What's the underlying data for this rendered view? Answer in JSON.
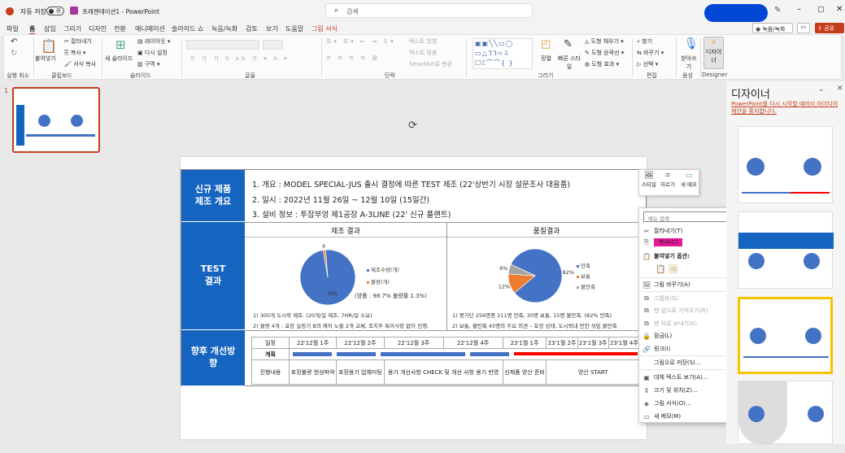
{
  "titlebar": {
    "autosave_label": "자동 저장",
    "autosave_state": "끔",
    "doc_title": "프레젠테이션1 - PowerPoint",
    "search_placeholder": "검색"
  },
  "tabs": [
    "파일",
    "홈",
    "삽입",
    "그리기",
    "디자인",
    "전환",
    "애니메이션",
    "슬라이드 쇼",
    "녹음/녹화",
    "검토",
    "보기",
    "도움말",
    "그림 서식"
  ],
  "header_buttons": {
    "record": "녹음/녹화",
    "share": "공유"
  },
  "ribbon": {
    "undo_group": "실행 취소",
    "clipboard": {
      "paste": "붙여넣기",
      "cut": "잘라내기",
      "copy": "복사",
      "format_painter": "서식 복사",
      "label": "클립보드"
    },
    "slides": {
      "new_slide": "새 슬라이드",
      "layout": "레이아웃",
      "reset": "다시 설정",
      "section": "구역",
      "label": "슬라이드"
    },
    "font": {
      "label": "글꼴"
    },
    "paragraph": {
      "text_direction": "텍스트 방향",
      "align_text": "텍스트 맞춤",
      "smartart": "SmartArt로 변환",
      "label": "단락"
    },
    "drawing": {
      "arrange": "정렬",
      "quick_styles": "빠른 스타일",
      "shape_fill": "도형 채우기",
      "shape_outline": "도형 윤곽선",
      "shape_effects": "도형 효과",
      "label": "그리기"
    },
    "editing": {
      "find": "찾기",
      "replace": "바꾸기",
      "select": "선택",
      "label": "편집"
    },
    "voice": {
      "dictate": "받아쓰기",
      "label": "음성"
    },
    "designer": {
      "button": "디자이너",
      "label": "Designer"
    }
  },
  "thumbnail": {
    "number": "1"
  },
  "slide": {
    "section1": "신규 제품 제조 개요",
    "overview": [
      "1. 개요 : MODEL SPECIAL-JUS 출시 결정에 따른 TEST 제조 (22'상반기 시장 설문조사 대응품)",
      "2. 일시 : 2022년 11월 26일 ~ 12월 10일 (15일간)",
      "3. 설비 정보 : 투잡부엉 제1공장 A-3LINE (22' 신규 플랜트)"
    ],
    "section2": "TEST 결과",
    "mfg_title": "제조 결과",
    "quality_title": "품질결과",
    "mfg_summary": "(양품 : 98.7% 불량률 1.3%)",
    "mfg_notes": [
      "1) 300개 도시락 제조. (20개/일 제조, 7HR/일 소요)",
      "2) 불량 4개 : 포장 실링기 B의 에어 노즐 2개 교체, 조치후 특이사항 없이 진행."
    ],
    "quality_notes": [
      "1) 평가단 256명중 211명 만족, 30명 보통, 15명 불만족. (82% 만족)",
      "2) 보통, 불만족 45명의 주요 의견 – 포장 상태, 도시락내 반찬 섞임 불만족"
    ],
    "section3": "향후 개선방향",
    "schedule": {
      "row_labels": [
        "일정",
        "계획",
        "진행내용"
      ],
      "weeks": [
        "22'12월 1주",
        "22'12월 2주",
        "22'12월 3주",
        "22'12월 4주",
        "23'1월 1주",
        "23'1월 2주",
        "23'1월 3주",
        "23'1월 4주"
      ],
      "tasks": [
        "포장불량 현상파악",
        "포장용기 업체미팅",
        "용기 개선사항 CHECK 및 개선 사항 용기 반영",
        "신제품 양산 준비",
        "양산 START"
      ]
    }
  },
  "chart_data": [
    {
      "type": "pie",
      "title": "제조 결과",
      "categories": [
        "제조수량(개)",
        "불량(개)"
      ],
      "values": [
        300,
        4
      ],
      "data_labels": [
        "300",
        "4"
      ],
      "colors": [
        "#4472c4",
        "#ed7d31"
      ],
      "legend": "right"
    },
    {
      "type": "pie",
      "title": "품질결과",
      "categories": [
        "만족",
        "보통",
        "불만족"
      ],
      "values": [
        82,
        12,
        6
      ],
      "data_labels": [
        "82%",
        "12%",
        "6%"
      ],
      "colors": [
        "#4472c4",
        "#ed7d31",
        "#a5a5a5"
      ],
      "legend": "right"
    }
  ],
  "mini_toolbar": {
    "style": "스타일",
    "crop": "자르기",
    "new_comment": "새 메모"
  },
  "context_menu": {
    "search_placeholder": "메뉴 검색",
    "items": [
      {
        "label": "잘라내기(T)",
        "icon": "scissors-icon",
        "enabled": true
      },
      {
        "label": "복사(C)",
        "icon": "copy-icon",
        "enabled": true
      },
      {
        "label": "붙여넣기 옵션:",
        "icon": "paste-icon",
        "enabled": true
      },
      {
        "label": "그림 바꾸기(A)",
        "icon": "change-picture-icon",
        "enabled": true,
        "submenu": true
      },
      {
        "label": "그룹화(G)",
        "icon": "group-icon",
        "enabled": false,
        "submenu": true
      },
      {
        "label": "맨 앞으로 가져오기(R)",
        "icon": "bring-front-icon",
        "enabled": false,
        "submenu": true
      },
      {
        "label": "맨 뒤로 보내기(K)",
        "icon": "send-back-icon",
        "enabled": false,
        "submenu": true
      },
      {
        "label": "잠금(L)",
        "icon": "lock-icon",
        "enabled": true
      },
      {
        "label": "링크(I)",
        "icon": "link-icon",
        "enabled": true,
        "submenu": true
      },
      {
        "label": "그림으로 저장(S)...",
        "icon": "",
        "enabled": true
      },
      {
        "label": "대체 텍스트 보기(A)...",
        "icon": "alt-text-icon",
        "enabled": true
      },
      {
        "label": "크기 및 위치(Z)...",
        "icon": "size-icon",
        "enabled": true
      },
      {
        "label": "그림 서식(O)...",
        "icon": "format-icon",
        "enabled": true
      },
      {
        "label": "새 메모(M)",
        "icon": "comment-icon",
        "enabled": true
      }
    ]
  },
  "designer_pane": {
    "title": "디자이너",
    "notice": "PowerPoint를 다시 시작할 때까지 아이디어 제안을 중지합니다."
  },
  "colors": {
    "accent": "#c43e1c",
    "slide_blue": "#1565c0",
    "highlight": "#e8179b"
  }
}
